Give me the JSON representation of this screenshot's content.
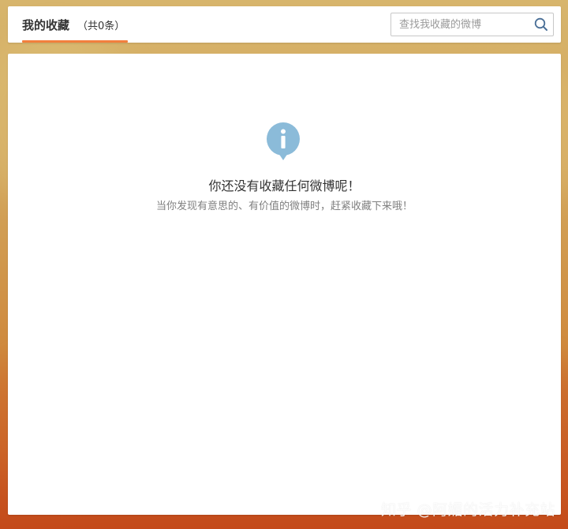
{
  "header": {
    "tab_title": "我的收藏",
    "tab_count": "（共0条）"
  },
  "search": {
    "placeholder": "查找我收藏的微博",
    "icon": "search-icon"
  },
  "empty_state": {
    "icon": "info-icon",
    "title": "你还没有收藏任何微博呢！",
    "subtitle": "当你发现有意思的、有价值的微博时，赶紧收藏下来哦！"
  },
  "watermark": "知乎 @阿媚的活力补充站",
  "colors": {
    "accent": "#f27f3d",
    "info_icon": "#8bbbd9",
    "panel": "#ffffff"
  }
}
